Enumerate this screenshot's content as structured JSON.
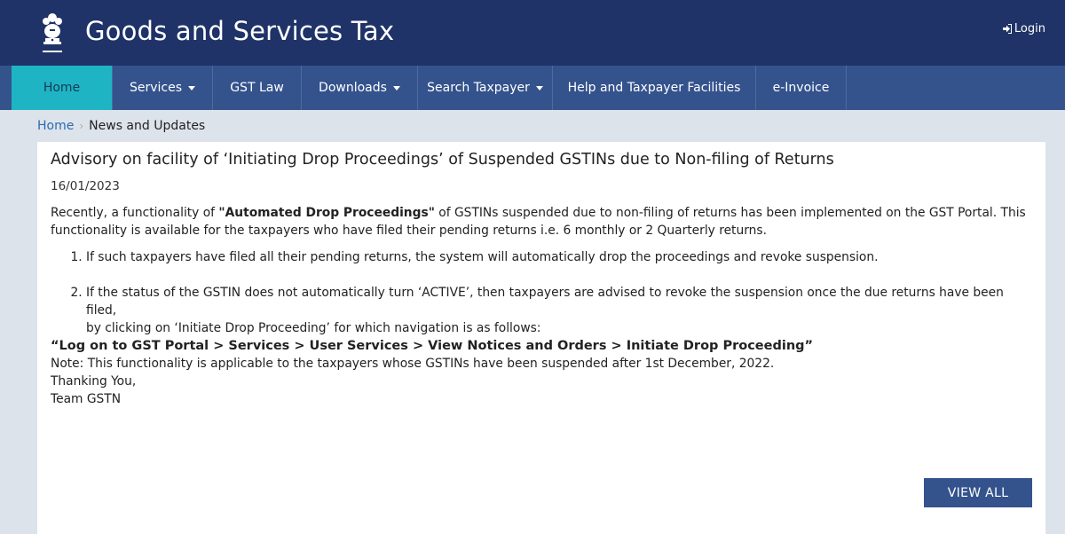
{
  "header": {
    "title": "Goods and Services Tax",
    "login_label": "Login",
    "emblem_icon": "national-emblem-icon",
    "login_icon": "sign-in-icon"
  },
  "nav": {
    "items": [
      {
        "label": "Home",
        "active": true,
        "dropdown": false
      },
      {
        "label": "Services",
        "active": false,
        "dropdown": true
      },
      {
        "label": "GST Law",
        "active": false,
        "dropdown": false
      },
      {
        "label": "Downloads",
        "active": false,
        "dropdown": true
      },
      {
        "label": "Search Taxpayer",
        "active": false,
        "dropdown": true
      },
      {
        "label": "Help and Taxpayer Facilities",
        "active": false,
        "dropdown": false
      },
      {
        "label": "e-Invoice",
        "active": false,
        "dropdown": false
      }
    ]
  },
  "breadcrumb": {
    "home": "Home",
    "current": "News and Updates"
  },
  "news": {
    "title": "Advisory on facility of ‘Initiating Drop Proceedings’ of Suspended GSTINs due to Non-filing of Returns",
    "date": "16/01/2023",
    "intro_pre": "Recently, a functionality of ",
    "intro_bold": "\"Automated Drop Proceedings\"",
    "intro_post": " of GSTINs suspended due to non-filing of returns has been implemented on the GST Portal. This",
    "intro_line2": "functionality is available for the taxpayers who have filed their pending returns i.e. 6 monthly or 2 Quarterly returns.",
    "point1": "If such taxpayers have filed all their pending returns, the system will automatically drop the proceedings and revoke suspension.",
    "point2_line1": "If the status of the GSTIN does not automatically turn ‘ACTIVE’, then taxpayers are advised to revoke the suspension once the due returns have been filed,",
    "point2_line2": "by clicking on ‘Initiate Drop Proceeding’ for which navigation is as follows:",
    "nav_path": "“Log on to GST Portal > Services > User Services > View Notices and Orders > Initiate Drop Proceeding”",
    "note": "Note: This functionality is applicable to the taxpayers whose GSTINs have been suspended after 1st December, 2022.",
    "thanks": "Thanking You,",
    "team": "Team GSTN"
  },
  "actions": {
    "view_all_label": "VIEW ALL"
  },
  "colors": {
    "header_bg": "#1f3368",
    "nav_bg": "#34538d",
    "nav_active_bg": "#1fb4c4",
    "page_bg": "#dde3ea",
    "link": "#2b6ab3"
  }
}
